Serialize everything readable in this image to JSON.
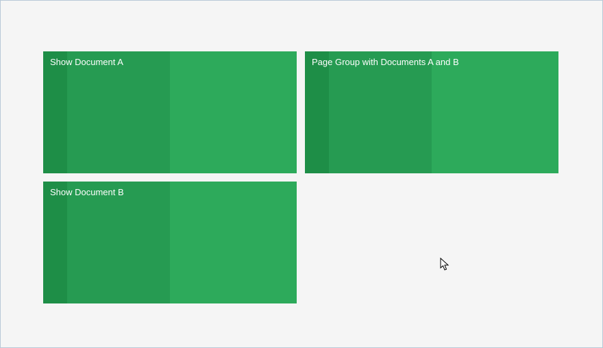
{
  "tiles": [
    {
      "label": "Show Document A"
    },
    {
      "label": "Page Group with Documents A and B"
    },
    {
      "label": "Show Document B"
    }
  ],
  "colors": {
    "band1": "#1e8e47",
    "band2": "#269b52",
    "band3": "#2daa5b",
    "background": "#f5f5f5",
    "border": "#b8c8d8",
    "text": "#ffffff"
  }
}
